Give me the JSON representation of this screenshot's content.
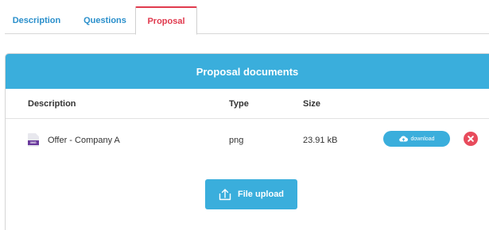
{
  "tabs": [
    {
      "label": "Description"
    },
    {
      "label": "Questions"
    },
    {
      "label": "Proposal",
      "active": true
    }
  ],
  "panel": {
    "title": "Proposal documents",
    "columns": {
      "description": "Description",
      "type": "Type",
      "size": "Size"
    },
    "rows": [
      {
        "description": "Offer - Company A",
        "type": "png",
        "size": "23.91 kB",
        "file_icon_tag": "IMG",
        "file_icon": "image-file-icon",
        "download_label": "download",
        "download_icon": "cloud-upload-icon",
        "delete_icon": "close-icon"
      }
    ],
    "upload_label": "File upload",
    "upload_icon": "upload-arrow-icon"
  },
  "colors": {
    "accent": "#3aaedc",
    "active_tab": "#e03a4e",
    "link_tab": "#2a8fcb",
    "delete": "#e84b5c"
  }
}
